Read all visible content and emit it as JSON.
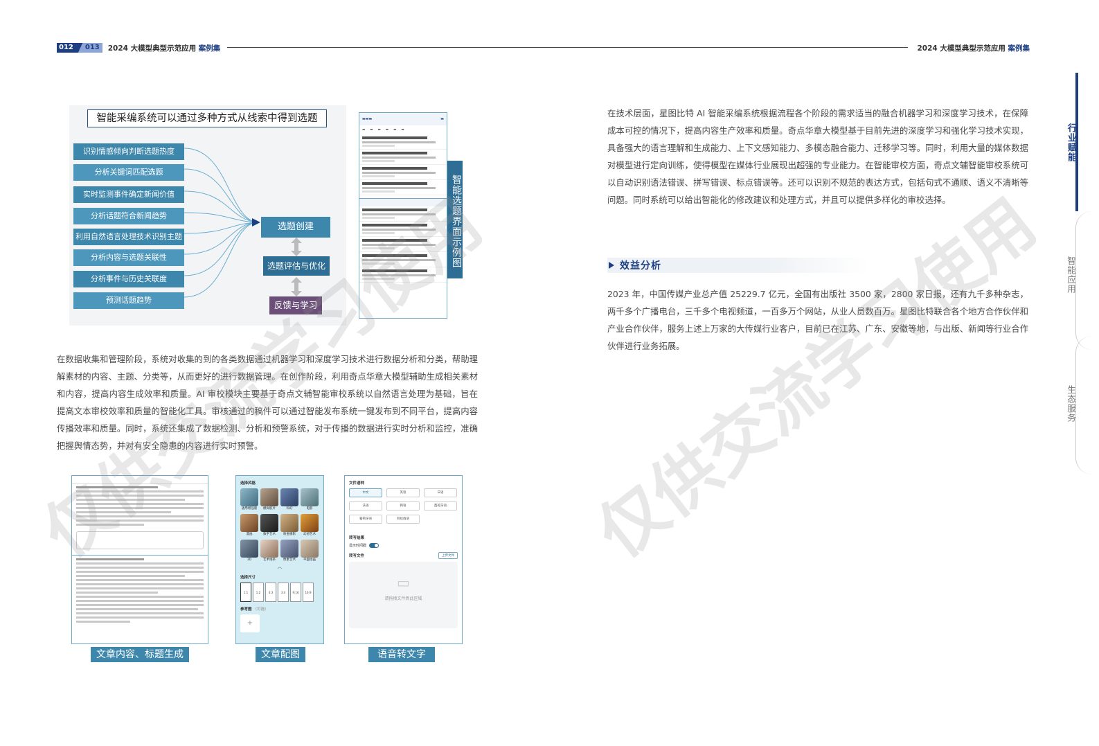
{
  "header": {
    "page_left": "012",
    "page_right": "013",
    "title_prefix": "2024 大模型典型示范应用",
    "title_suffix": "案例集"
  },
  "side_tabs": {
    "tab1": "行业赋能",
    "tab2": "智能应用",
    "tab3": "生态服务",
    "active_color": "#1d3f82"
  },
  "mindmap": {
    "title": "智能采编系统可以通过多种方式从线索中得到选题",
    "sources": [
      "识别情感倾向判断选题热度",
      "分析关键词匹配选题",
      "实时监测事件确定新闻价值",
      "分析话题符合新闻趋势",
      "利用自然语言处理技术识别主题",
      "分析内容与选题关联性",
      "分析事件与历史关联度",
      "预测话题趋势"
    ],
    "center": "选题创建",
    "evaluate": "选题评估与优化",
    "feedback": "反馈与学习"
  },
  "topic_screen_caption": "智能选题界面示例图",
  "para_left": "在数据收集和管理阶段，系统对收集的到的各类数据通过机器学习和深度学习技术进行数据分析和分类，帮助理解素材的内容、主题、分类等，从而更好的进行数据管理。在创作阶段，利用奇点华章大模型辅助生成相关素材和内容，提高内容生成效率和质量。AI 审校模块主要基于奇点文辅智能审校系统以自然语言处理为基础，旨在提高文本审校效率和质量的智能化工具。审核通过的稿件可以通过智能发布系统一键发布到不同平台，提高内容传播效率和质量。同时，系统还集成了数据检测、分析和预警系统，对于传播的数据进行实时分析和监控，准确把握舆情态势，并对有安全隐患的内容进行实时预警。",
  "captions": {
    "article": "文章内容、标题生成",
    "illustration": "文章配图",
    "speech": "语音转文字"
  },
  "illustration_screen": {
    "style_label": "选择风格",
    "styles": [
      "通用增强版",
      "模拟胶片",
      "科幻",
      "电影",
      "漫画",
      "数字艺术",
      "粉金摄影",
      "幻想艺术",
      "3D",
      "艺术线条",
      "像素艺术",
      "平面绘画"
    ],
    "size_label": "选择尺寸",
    "ratios": [
      "1:1",
      "1:2",
      "4:3",
      "3:4",
      "9:16",
      "16:9"
    ],
    "ref_label": "参考图",
    "ref_hint": "（可选）"
  },
  "speech_screen": {
    "lang_label": "文件语种",
    "langs": [
      "中文",
      "英语",
      "日语",
      "法语",
      "韩语",
      "西班牙语",
      "葡萄牙语",
      "阿拉伯语"
    ],
    "result_label": "转写结果",
    "show_time": "显示时间戳",
    "file_label": "转写文件",
    "upload": "上传文件",
    "drop_hint": "请拖拽文件到此区域"
  },
  "para_r1": "在技术层面，星图比特 AI 智能采编系统根据流程各个阶段的需求适当的融合机器学习和深度学习技术，在保障成本可控的情况下，提高内容生产效率和质量。奇点华章大模型基于目前先进的深度学习和强化学习技术实现，具备强大的语言理解和生成能力、上下文感知能力、多模态融合能力、迁移学习等。同时，利用大量的媒体数据对模型进行定向训练，使得模型在媒体行业展现出超强的专业能力。在智能审校方面，奇点文辅智能审校系统可以自动识别语法错误、拼写错误、标点错误等。还可以识别不规范的表达方式，包括句式不通顺、语义不清晰等问题。同时系统可以给出智能化的修改建议和处理方式，并且可以提供多样化的审校选择。",
  "section_title": "效益分析",
  "para_r2": "2023 年，中国传媒产业总产值 25229.7 亿元，全国有出版社 3500 家，2800 家日报，还有九千多种杂志，两千多个广播电台，三千多个电视频道，一百多万个网站，从业人员数百万。星图比特联合各个地方合作伙伴和产业合作伙伴，服务上述上万家的大传媒行业客户，目前已在江苏、广东、安徽等地，与出版、新闻等行业合作伙伴进行业务拓展。",
  "watermark": "仅供交流学习使用"
}
